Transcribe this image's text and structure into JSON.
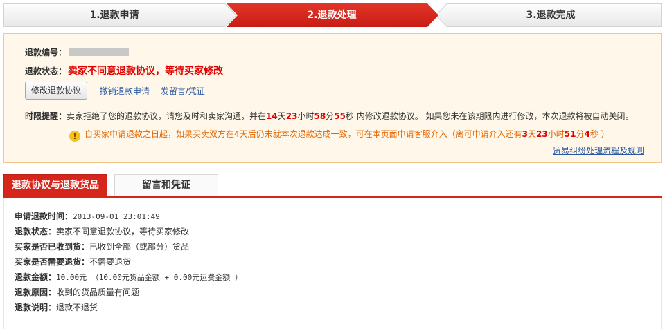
{
  "steps": [
    {
      "label": "1.退款申请",
      "state": "done"
    },
    {
      "label": "2.退款处理",
      "state": "current"
    },
    {
      "label": "3.退款完成",
      "state": "todo"
    }
  ],
  "colors": {
    "accent": "#d6261c",
    "notice_bg": "#fff8ea",
    "notice_border": "#f3c78a",
    "link": "#2b58a0",
    "warn": "#e56600",
    "alert_red": "#e00000"
  },
  "notice": {
    "refund_no_label": "退款编号：",
    "refund_no_value_redacted": true,
    "status_label": "退款状态：",
    "status_value": "卖家不同意退款协议，等待买家修改",
    "modify_button": "修改退款协议",
    "cancel_link": "撤销退款申请",
    "message_link": "发留言/凭证",
    "deadline": {
      "label": "时限提醒：",
      "text_before": "卖家拒绝了您的退款协议，请您及时和卖家沟通，并在",
      "days": "14",
      "days_unit": "天",
      "hours": "23",
      "hours_unit": "小时",
      "minutes": "58",
      "minutes_unit": "分",
      "seconds": "55",
      "seconds_unit": "秒",
      "text_after": " 内修改退款协议。 如果您未在该期限内进行修改，本次退款将被自动关闭。"
    },
    "warning": {
      "icon": "exclamation-icon",
      "text_before": "自买家申请退款之日起，如果买卖双方在4天后仍未就本次退款达成一致，可在本页面申请客服介入（离可申请介入还有",
      "days": "3",
      "days_unit": "天",
      "hours": "23",
      "hours_unit": "小时",
      "minutes": "51",
      "minutes_unit": "分",
      "seconds": "4",
      "seconds_unit": "秒",
      "text_after": " ）"
    },
    "rules_link": "贸易纠纷处理流程及规则"
  },
  "tabs": [
    {
      "label": "退款协议与退款货品",
      "active": true
    },
    {
      "label": "留言和凭证",
      "active": false
    }
  ],
  "details": {
    "apply_time_label": "申请退款时间：",
    "apply_time_value": "2013-09-01 23:01:49",
    "status_label": "退款状态：",
    "status_value": "卖家不同意退款协议，等待买家修改",
    "received_label": "买家是否已收到货：",
    "received_value": "已收到全部（或部分）货品",
    "need_return_label": "买家是否需要退货：",
    "need_return_value": "不需要退货",
    "amount_label": "退款金额：",
    "amount_value": "10.00元 （10.00元货品金额 + 0.00元运费金额 ）",
    "reason_label": "退款原因：",
    "reason_value": "收到的货品质量有问题",
    "desc_label": "退款说明：",
    "desc_value": "退款不退货"
  }
}
